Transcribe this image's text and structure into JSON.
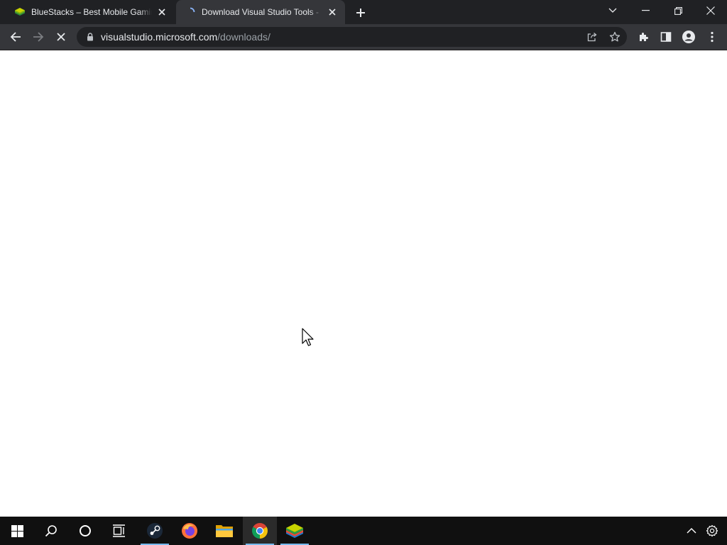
{
  "browser": {
    "tabs": [
      {
        "title": "BlueStacks – Best Mobile Gaming Platform",
        "favicon": "bluestacks-icon",
        "active": false
      },
      {
        "title": "Download Visual Studio Tools - Install",
        "favicon": "loading-spinner-icon",
        "active": true
      }
    ],
    "address": {
      "host": "visualstudio.microsoft.com",
      "path": "/downloads/"
    }
  },
  "colors": {
    "tabstrip": "#202124",
    "active_tab": "#35363a",
    "omnibox": "#202124",
    "page": "#ffffff",
    "taskbar": "#101010",
    "taskbar_indicator": "#76b9ed"
  },
  "taskbar": {
    "items": [
      "windows-start-icon",
      "search-icon",
      "cortana-icon",
      "task-view-icon",
      "steam-icon",
      "firefox-icon",
      "file-explorer-icon",
      "chrome-icon",
      "bluestacks-icon"
    ],
    "active": "chrome-icon",
    "tray": [
      "show-hidden-icons-chevron",
      "settings-gear-icon"
    ]
  }
}
